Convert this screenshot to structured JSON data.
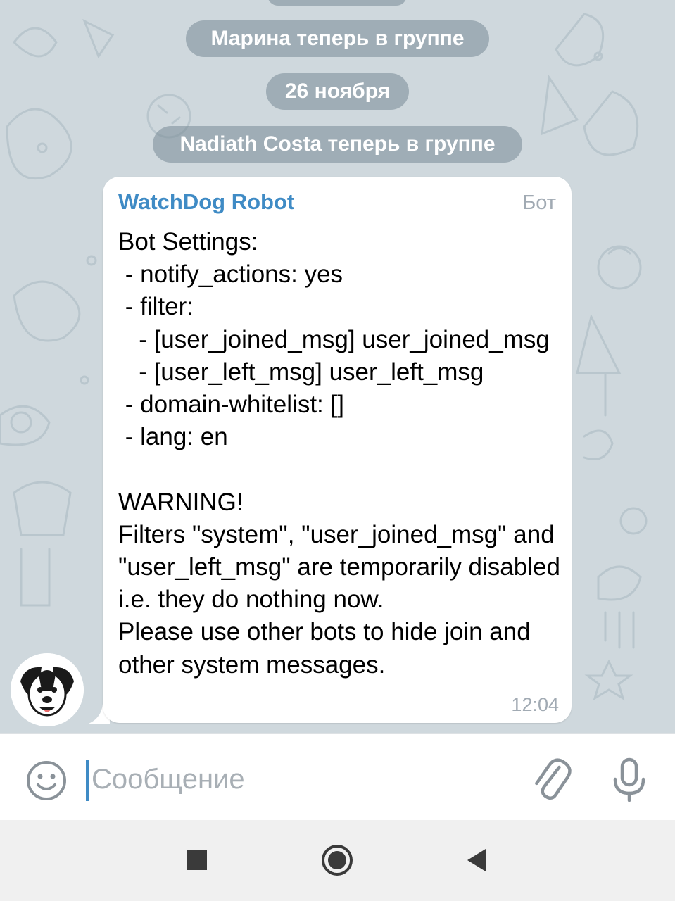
{
  "chat": {
    "service_messages": [
      {
        "text": "Марина теперь в группе"
      },
      {
        "text": "26 ноября"
      },
      {
        "text": "Nadiath Costa теперь в группе"
      }
    ],
    "message": {
      "sender": "WatchDog Robot",
      "badge": "Бот",
      "text": "Bot Settings:\n - notify_actions: yes\n - filter:\n   - [user_joined_msg] user_joined_msg\n   - [user_left_msg] user_left_msg\n - domain-whitelist: []\n - lang: en\n\nWARNING!\nFilters \"system\", \"user_joined_msg\" and \"user_left_msg\" are temporarily disabled i.e. they do nothing now.\nPlease use other bots to hide join and other system messages.",
      "time": "12:04",
      "avatar_icon": "dog-avatar-icon"
    }
  },
  "input_bar": {
    "placeholder": "Сообщение",
    "emoji_icon": "emoji-icon",
    "attach_icon": "paperclip-icon",
    "mic_icon": "microphone-icon"
  },
  "nav_bar": {
    "icons": [
      "recents-square-icon",
      "home-circle-icon",
      "back-triangle-icon"
    ]
  },
  "colors": {
    "accent": "#3f8bc5",
    "chat_background": "#cfd8dd",
    "service_pill": "#7f8f9a"
  }
}
